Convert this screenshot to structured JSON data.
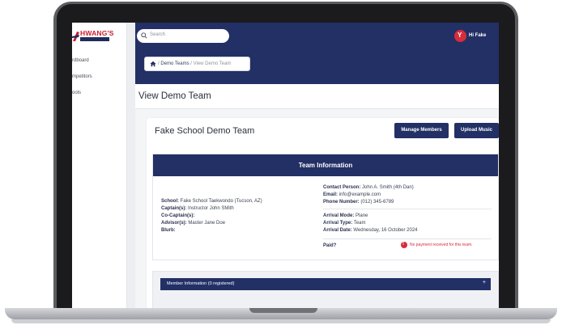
{
  "app": {
    "logo_text": "HWANG'S",
    "sidebar": {
      "items": [
        {
          "label": "rdboard"
        },
        {
          "label": "mpetitors"
        },
        {
          "label": "ools"
        }
      ]
    },
    "header": {
      "search_placeholder": "Search",
      "user_name": "Hi Fake",
      "avatar_glyph": "Y"
    },
    "breadcrumb": {
      "home_icon": "home-icon",
      "items": [
        "Demo Teams",
        "View Demo Team"
      ],
      "separator": "/"
    }
  },
  "page": {
    "title": "View Demo Team",
    "team_card": {
      "title": "Fake School Demo Team",
      "manage_members_label": "Manage Members",
      "upload_music_label": "Upload Music"
    },
    "team_information": {
      "header": "Team Information",
      "left": [
        {
          "label": "School:",
          "value": "Fake School Taekwondo (Tucson, AZ)"
        },
        {
          "label": "Captain(s):",
          "value": "Instructor John SMith"
        },
        {
          "label": "Co-Captain(s):",
          "value": ""
        },
        {
          "label": "Advisor(s):",
          "value": "Master Jane Doe"
        },
        {
          "label": "Blurb:",
          "value": ""
        }
      ],
      "right_contact": [
        {
          "label": "Contact Person:",
          "value": "John A. Smith (4th Dan)"
        },
        {
          "label": "Email:",
          "value": "info@example.com"
        },
        {
          "label": "Phone Number:",
          "value": "(012) 345-6789"
        }
      ],
      "right_arrival": [
        {
          "label": "Arrival Mode:",
          "value": "Plane"
        },
        {
          "label": "Arrival Type:",
          "value": "Team"
        },
        {
          "label": "Arrival Date:",
          "value": "Wednesday, 16 October 2024"
        }
      ],
      "paid_label": "Paid?",
      "payment_icon": "alert-icon",
      "payment_message": "No payment received for this team."
    },
    "member_information": {
      "title": "Member Information (0 registered)",
      "toggle": "+"
    }
  },
  "colors": {
    "primary": "#233066",
    "danger": "#d72c3b",
    "brand_red": "#c8202f"
  }
}
